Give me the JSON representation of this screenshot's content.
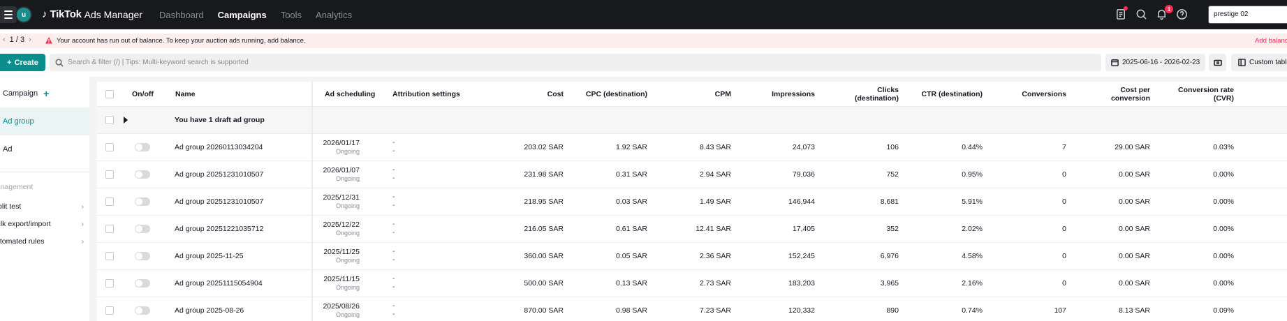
{
  "topbar": {
    "avatar_letter": "u",
    "logo_brand": "TikTok",
    "logo_product": "Ads Manager",
    "nav": [
      "Dashboard",
      "Campaigns",
      "Tools",
      "Analytics"
    ],
    "active_nav": "Campaigns",
    "notification_count": "1",
    "account_name": "prestige 02"
  },
  "alert": {
    "pager": "1 / 3",
    "message": "Your account has run out of balance. To keep your auction ads running, add balance.",
    "action": "Add balance"
  },
  "toolbar": {
    "create_label": "Create",
    "search_placeholder": "Search & filter (/) | Tips: Multi-keyword search is supported",
    "date_range": "2025-06-16 - 2026-02-23",
    "custom_table_label": "Custom table"
  },
  "sidebar": {
    "campaign_label": "Campaign",
    "ad_group_label": "Ad group",
    "ad_label": "Ad",
    "section_title": "Management",
    "links": [
      "Split test",
      "Bulk export/import",
      "Automated rules"
    ]
  },
  "table": {
    "headers": {
      "onoff": "On/off",
      "name": "Name",
      "scheduling": "Ad scheduling",
      "attribution": "Attribution settings",
      "cost": "Cost",
      "cpc": "CPC (destination)",
      "cpm": "CPM",
      "impressions": "Impressions",
      "clicks_1": "Clicks",
      "clicks_2": "(destination)",
      "ctr": "CTR (destination)",
      "conversions": "Conversions",
      "cpconv_1": "Cost per",
      "cpconv_2": "conversion",
      "cvr_1": "Conversion rate",
      "cvr_2": "(CVR)"
    },
    "draft_text": "You have 1 draft ad group",
    "rows": [
      {
        "name": "Ad group 20260113034204",
        "date": "2026/01/17",
        "status": "Ongoing",
        "attr1": "-",
        "attr2": "-",
        "cost": "203.02 SAR",
        "cpc": "1.92 SAR",
        "cpm": "8.43 SAR",
        "impressions": "24,073",
        "clicks": "106",
        "ctr": "0.44%",
        "conversions": "7",
        "cpconv": "29.00 SAR",
        "cvr": "0.03%"
      },
      {
        "name": "Ad group 20251231010507",
        "date": "2026/01/07",
        "status": "Ongoing",
        "attr1": "-",
        "attr2": "-",
        "cost": "231.98 SAR",
        "cpc": "0.31 SAR",
        "cpm": "2.94 SAR",
        "impressions": "79,036",
        "clicks": "752",
        "ctr": "0.95%",
        "conversions": "0",
        "cpconv": "0.00 SAR",
        "cvr": "0.00%"
      },
      {
        "name": "Ad group 20251231010507",
        "date": "2025/12/31",
        "status": "Ongoing",
        "attr1": "-",
        "attr2": "-",
        "cost": "218.95 SAR",
        "cpc": "0.03 SAR",
        "cpm": "1.49 SAR",
        "impressions": "146,944",
        "clicks": "8,681",
        "ctr": "5.91%",
        "conversions": "0",
        "cpconv": "0.00 SAR",
        "cvr": "0.00%"
      },
      {
        "name": "Ad group 20251221035712",
        "date": "2025/12/22",
        "status": "Ongoing",
        "attr1": "-",
        "attr2": "-",
        "cost": "216.05 SAR",
        "cpc": "0.61 SAR",
        "cpm": "12.41 SAR",
        "impressions": "17,405",
        "clicks": "352",
        "ctr": "2.02%",
        "conversions": "0",
        "cpconv": "0.00 SAR",
        "cvr": "0.00%"
      },
      {
        "name": "Ad group 2025-11-25",
        "date": "2025/11/25",
        "status": "Ongoing",
        "attr1": "-",
        "attr2": "-",
        "cost": "360.00 SAR",
        "cpc": "0.05 SAR",
        "cpm": "2.36 SAR",
        "impressions": "152,245",
        "clicks": "6,976",
        "ctr": "4.58%",
        "conversions": "0",
        "cpconv": "0.00 SAR",
        "cvr": "0.00%"
      },
      {
        "name": "Ad group 20251115054904",
        "date": "2025/11/15",
        "status": "Ongoing",
        "attr1": "-",
        "attr2": "-",
        "cost": "500.00 SAR",
        "cpc": "0.13 SAR",
        "cpm": "2.73 SAR",
        "impressions": "183,203",
        "clicks": "3,965",
        "ctr": "2.16%",
        "conversions": "0",
        "cpconv": "0.00 SAR",
        "cvr": "0.00%"
      },
      {
        "name": "Ad group 2025-08-26",
        "date": "2025/08/26",
        "status": "Ongoing",
        "attr1": "-",
        "attr2": "-",
        "cost": "870.00 SAR",
        "cpc": "0.98 SAR",
        "cpm": "7.23 SAR",
        "impressions": "120,332",
        "clicks": "890",
        "ctr": "0.74%",
        "conversions": "107",
        "cpconv": "8.13 SAR",
        "cvr": "0.09%"
      }
    ]
  },
  "colors": {
    "accent": "#0b8d8b",
    "topbar_bg": "#18191c",
    "alert_bg": "#fdeeee",
    "danger": "#fe2c55"
  },
  "icons": [
    "menu-icon",
    "tiktok-note-icon",
    "task-icon",
    "search-icon",
    "bell-icon",
    "help-icon",
    "warning-icon",
    "calendar-icon",
    "compare-icon",
    "table-columns-icon",
    "chevron-right-icon",
    "caret-right-icon"
  ]
}
